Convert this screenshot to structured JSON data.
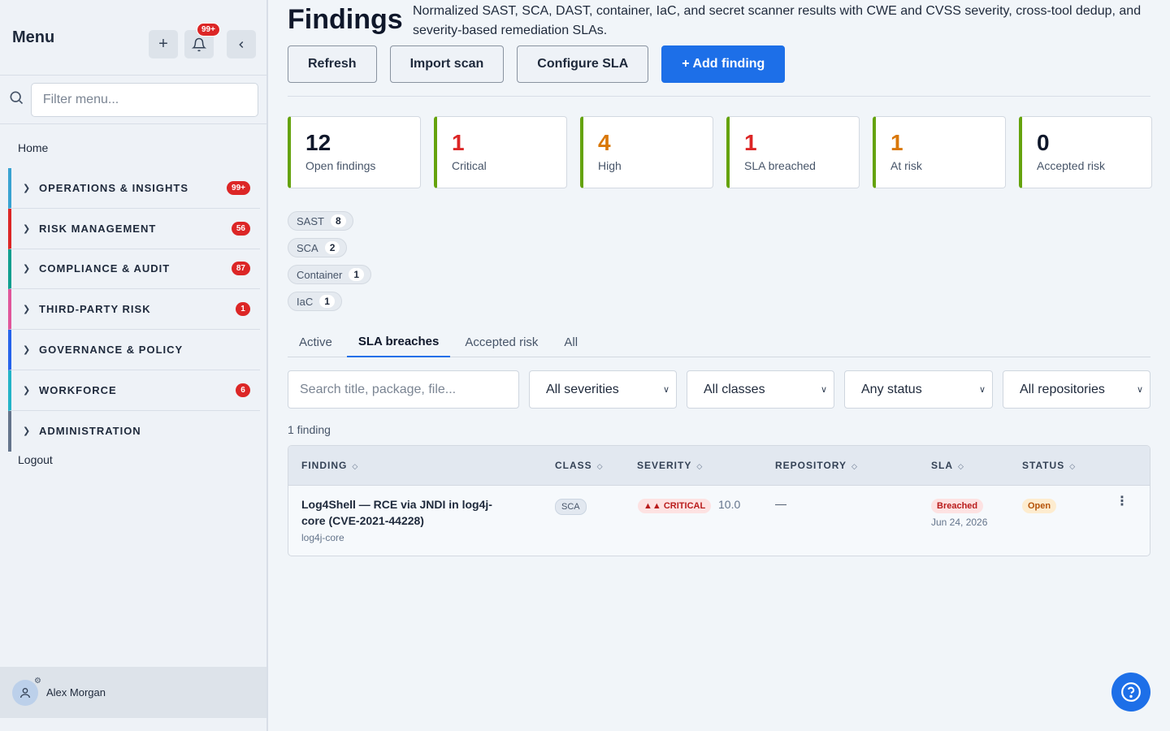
{
  "sidebar": {
    "title": "Menu",
    "notification_badge": "99+",
    "filter_placeholder": "Filter menu...",
    "home": "Home",
    "items": [
      {
        "label": "OPERATIONS & INSIGHTS",
        "count": "99+",
        "color": "#38a3d1"
      },
      {
        "label": "RISK MANAGEMENT",
        "count": "56",
        "color": "#dc2626"
      },
      {
        "label": "COMPLIANCE & AUDIT",
        "count": "87",
        "color": "#0f9f8f"
      },
      {
        "label": "THIRD-PARTY RISK",
        "count": "1",
        "color": "#e0569b"
      },
      {
        "label": "GOVERNANCE & POLICY",
        "count": "",
        "color": "#2563eb"
      },
      {
        "label": "WORKFORCE",
        "count": "6",
        "color": "#22b3c7"
      },
      {
        "label": "ADMINISTRATION",
        "count": "",
        "color": "#64748b"
      }
    ],
    "logout": "Logout",
    "user_name": "Alex Morgan"
  },
  "header": {
    "title": "Findings",
    "description": "Normalized SAST, SCA, DAST, container, IaC, and secret scanner results with CWE and CVSS severity, cross-tool dedup, and severity-based remediation SLAs."
  },
  "actions": {
    "refresh": "Refresh",
    "import": "Import scan",
    "configure": "Configure SLA",
    "add": "+ Add finding"
  },
  "stats": [
    {
      "value": "12",
      "label": "Open findings",
      "color": "#0f172a"
    },
    {
      "value": "1",
      "label": "Critical",
      "color": "#dc2626"
    },
    {
      "value": "4",
      "label": "High",
      "color": "#d97706"
    },
    {
      "value": "1",
      "label": "SLA breached",
      "color": "#dc2626"
    },
    {
      "value": "1",
      "label": "At risk",
      "color": "#d97706"
    },
    {
      "value": "0",
      "label": "Accepted risk",
      "color": "#0f172a"
    }
  ],
  "scanner_tags": [
    {
      "label": "SAST",
      "count": "8"
    },
    {
      "label": "SCA",
      "count": "2"
    },
    {
      "label": "Container",
      "count": "1"
    },
    {
      "label": "IaC",
      "count": "1"
    }
  ],
  "tabs": [
    "Active",
    "SLA breaches",
    "Accepted risk",
    "All"
  ],
  "filters": {
    "search_placeholder": "Search title, package, file...",
    "severity": "All severities",
    "class": "All classes",
    "status": "Any status",
    "repository": "All repositories"
  },
  "result_count": "1 finding",
  "table": {
    "headers": [
      "FINDING",
      "CLASS",
      "SEVERITY",
      "REPOSITORY",
      "SLA",
      "STATUS"
    ],
    "rows": [
      {
        "title": "Log4Shell — RCE via JNDI in log4j-core (CVE-2021-44228)",
        "package": "log4j-core",
        "class": "SCA",
        "severity": "CRITICAL",
        "score": "10.0",
        "repository": "—",
        "sla": "Breached",
        "sla_date": "Jun 24, 2026",
        "status": "Open"
      }
    ]
  }
}
